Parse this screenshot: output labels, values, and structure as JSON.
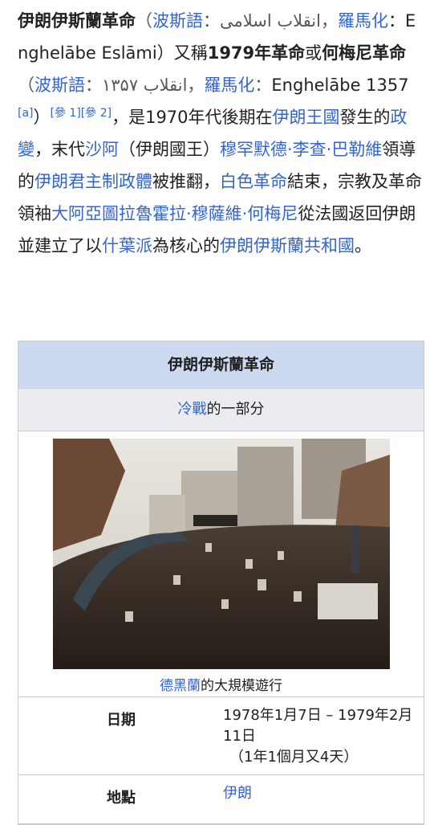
{
  "article": {
    "title_bold": "伊朗伊斯蘭革命",
    "open_paren": "（",
    "lang_link_1": "波斯語",
    "colon": "：",
    "persian_1": "انقلاب اسلامی",
    "comma": "，",
    "roman_link_1": "羅馬化",
    "roman_1": "：Enghelābe Eslāmi）又稱",
    "alt_bold_1": "1979年革命",
    "or": "或",
    "alt_bold_2": "何梅尼革命",
    "open_paren_2": "（",
    "lang_link_2": "波斯語",
    "colon_2": "：",
    "persian_2": "انقلاب ۱۳۵۷",
    "comma_2": "，",
    "roman_link_2": "羅馬化",
    "colon_3": "：",
    "roman_2": "Enghelābe 1357",
    "note_a": "[a]",
    "close_paren": "）",
    "ref_1": "[參 1]",
    "ref_2": "[參 2]",
    "t1": "，是1970年代後期在",
    "l_iran_kingdom": "伊朗王國",
    "t2": "發生的",
    "l_coup": "政變",
    "t3": "，末代",
    "l_shah": "沙阿",
    "t4": "（伊朗國王）",
    "l_pahlavi": "穆罕默德·李查·巴勒維",
    "t5": "領導的",
    "l_monarchy": "伊朗君主制政體",
    "t6": "被推翻，",
    "l_white": "白色革命",
    "t7": "結束，宗教及革命領袖",
    "l_khomeini": "大阿亞圖拉魯霍拉·穆薩維·何梅尼",
    "t8": "從法國返回伊朗並建立了以",
    "l_shia": "什葉派",
    "t9": "為核心的",
    "l_republic": "伊朗伊斯蘭共和國",
    "t10": "。"
  },
  "infobox": {
    "title": "伊朗伊斯蘭革命",
    "part_link": "冷戰",
    "part_suffix": "的一部分",
    "caption_link": "德黑蘭",
    "caption_suffix": "的大規模遊行",
    "date_label": "日期",
    "date_value": "1978年1月7日 – 1979年2月11日",
    "date_duration": "（1年1個月又4天）",
    "place_label": "地點",
    "place_value": "伊朗"
  },
  "colors": {
    "link": "#3366cc",
    "infobox_header": "#ccd9ef",
    "infobox_subheader": "#eaecf0",
    "border": "#c8ccd1"
  }
}
